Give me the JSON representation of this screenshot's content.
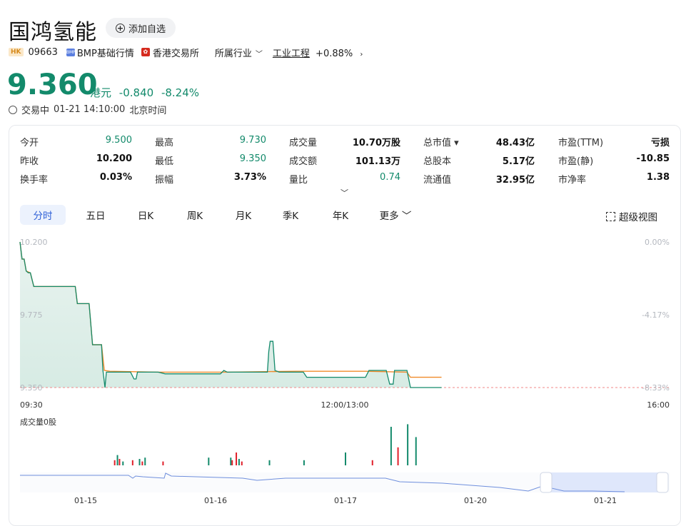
{
  "header": {
    "name": "国鸿氢能",
    "add_watch": "添加自选",
    "market_badge": "HK",
    "code": "09663",
    "bmp_label": "BMP基础行情",
    "exchange": "香港交易所",
    "industry_menu": "所属行业",
    "industry": "工业工程",
    "industry_change": "+0.88%"
  },
  "quote": {
    "price": "9.360",
    "currency": "港元",
    "change": "-0.840",
    "change_pct": "-8.24%",
    "status": "交易中",
    "time": "01-21 14:10:00",
    "tz": "北京时间"
  },
  "stats": [
    {
      "label": "今开",
      "value": "9.500",
      "color": "green"
    },
    {
      "label": "最高",
      "value": "9.730",
      "color": "green"
    },
    {
      "label": "成交量",
      "value": "10.70万股",
      "color": "dark"
    },
    {
      "label": "总市值",
      "value": "48.43亿",
      "color": "dark",
      "has_caret": true
    },
    {
      "label": "市盈(TTM)",
      "value": "亏损",
      "color": "dark"
    },
    {
      "label": "昨收",
      "value": "10.200",
      "color": "dark"
    },
    {
      "label": "最低",
      "value": "9.350",
      "color": "green"
    },
    {
      "label": "成交额",
      "value": "101.13万",
      "color": "dark"
    },
    {
      "label": "总股本",
      "value": "5.17亿",
      "color": "dark"
    },
    {
      "label": "市盈(静)",
      "value": "-10.85",
      "color": "dark"
    },
    {
      "label": "换手率",
      "value": "0.03%",
      "color": "dark"
    },
    {
      "label": "振幅",
      "value": "3.73%",
      "color": "dark"
    },
    {
      "label": "量比",
      "value": "0.74",
      "color": "green"
    },
    {
      "label": "流通值",
      "value": "32.95亿",
      "color": "dark"
    },
    {
      "label": "市净率",
      "value": "1.38",
      "color": "dark"
    }
  ],
  "tabs": [
    "分时",
    "五日",
    "日K",
    "周K",
    "月K",
    "季K",
    "年K",
    "更多"
  ],
  "fullscreen_label": "超级视图",
  "colors": {
    "up": "#e0202a",
    "down": "#138a6b",
    "avg": "#f08b2a",
    "accent": "#2c5ed6"
  },
  "chart_data": {
    "type": "line",
    "y_labels_left": [
      "10.200",
      "9.775",
      "9.350"
    ],
    "y_labels_right": [
      "0.00%",
      "-4.17%",
      "-8.33%"
    ],
    "x_labels": [
      "09:30",
      "12:00/13:00",
      "16:00"
    ],
    "ylim": [
      9.35,
      10.2
    ],
    "prev_close": 10.2,
    "volume_label": "成交量0股",
    "price_series": [
      [
        0,
        10.2
      ],
      [
        3,
        10.1
      ],
      [
        6,
        10.1
      ],
      [
        9,
        10.03
      ],
      [
        12,
        10.02
      ],
      [
        15,
        10.02
      ],
      [
        20,
        9.94
      ],
      [
        30,
        9.94
      ],
      [
        60,
        9.94
      ],
      [
        70,
        9.94
      ],
      [
        80,
        9.94
      ],
      [
        83,
        9.84
      ],
      [
        90,
        9.84
      ],
      [
        95,
        9.84
      ],
      [
        100,
        9.84
      ],
      [
        105,
        9.6
      ],
      [
        110,
        9.6
      ],
      [
        115,
        9.6
      ],
      [
        118,
        9.6
      ],
      [
        120,
        9.45
      ],
      [
        123,
        9.35
      ],
      [
        125,
        9.44
      ],
      [
        130,
        9.44
      ],
      [
        135,
        9.44
      ],
      [
        150,
        9.44
      ],
      [
        160,
        9.44
      ],
      [
        165,
        9.4
      ],
      [
        168,
        9.4
      ],
      [
        170,
        9.44
      ],
      [
        180,
        9.44
      ],
      [
        190,
        9.44
      ],
      [
        200,
        9.44
      ],
      [
        210,
        9.43
      ],
      [
        230,
        9.43
      ],
      [
        260,
        9.43
      ],
      [
        290,
        9.43
      ],
      [
        295,
        9.45
      ],
      [
        300,
        9.44
      ],
      [
        320,
        9.44
      ],
      [
        340,
        9.44
      ],
      [
        358,
        9.44
      ],
      [
        360,
        9.56
      ],
      [
        362,
        9.62
      ],
      [
        366,
        9.62
      ],
      [
        369,
        9.45
      ],
      [
        375,
        9.44
      ],
      [
        400,
        9.44
      ],
      [
        410,
        9.44
      ],
      [
        415,
        9.41
      ],
      [
        440,
        9.41
      ],
      [
        470,
        9.41
      ],
      [
        500,
        9.41
      ],
      [
        505,
        9.45
      ],
      [
        520,
        9.45
      ],
      [
        530,
        9.45
      ],
      [
        535,
        9.37
      ],
      [
        540,
        9.37
      ],
      [
        542,
        9.45
      ],
      [
        560,
        9.45
      ],
      [
        565,
        9.35
      ],
      [
        580,
        9.35
      ],
      [
        600,
        9.35
      ],
      [
        610,
        9.35
      ]
    ],
    "avg_series": [
      [
        0,
        10.2
      ],
      [
        3,
        10.1
      ],
      [
        6,
        10.1
      ],
      [
        9,
        10.03
      ],
      [
        15,
        10.02
      ],
      [
        20,
        9.94
      ],
      [
        80,
        9.94
      ],
      [
        83,
        9.84
      ],
      [
        100,
        9.84
      ],
      [
        105,
        9.6
      ],
      [
        118,
        9.6
      ],
      [
        122,
        9.45
      ],
      [
        130,
        9.445
      ],
      [
        200,
        9.44
      ],
      [
        300,
        9.44
      ],
      [
        400,
        9.445
      ],
      [
        500,
        9.445
      ],
      [
        560,
        9.44
      ],
      [
        565,
        9.41
      ],
      [
        600,
        9.41
      ],
      [
        610,
        9.41
      ]
    ],
    "volume_bars": [
      [
        136,
        4,
        "up"
      ],
      [
        140,
        8,
        "down"
      ],
      [
        143,
        5,
        "up"
      ],
      [
        148,
        3,
        "down"
      ],
      [
        162,
        4,
        "up"
      ],
      [
        172,
        5,
        "down"
      ],
      [
        176,
        3,
        "up"
      ],
      [
        180,
        6,
        "down"
      ],
      [
        206,
        3,
        "up"
      ],
      [
        272,
        6,
        "down"
      ],
      [
        304,
        6,
        "down"
      ],
      [
        306,
        4,
        "up"
      ],
      [
        312,
        10,
        "up"
      ],
      [
        316,
        5,
        "down"
      ],
      [
        320,
        3,
        "up"
      ],
      [
        360,
        4,
        "down"
      ],
      [
        410,
        4,
        "down"
      ],
      [
        470,
        10,
        "down"
      ],
      [
        509,
        4,
        "up"
      ],
      [
        536,
        30,
        "down"
      ],
      [
        546,
        14,
        "up"
      ],
      [
        560,
        32,
        "down"
      ],
      [
        572,
        22,
        "down"
      ]
    ],
    "nav_dates": [
      "01-15",
      "01-16",
      "01-17",
      "01-20",
      "01-21"
    ]
  }
}
